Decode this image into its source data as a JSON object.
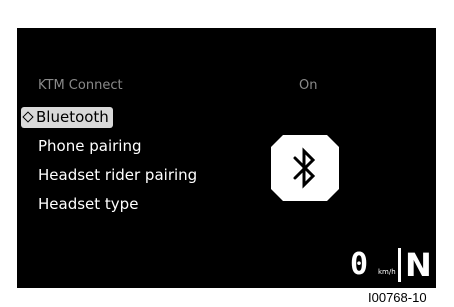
{
  "menu": {
    "header_label": "KTM Connect",
    "header_status": "On",
    "items": [
      {
        "label": "Bluetooth",
        "selected": true
      },
      {
        "label": "Phone pairing",
        "selected": false
      },
      {
        "label": "Headset rider pairing",
        "selected": false
      },
      {
        "label": "Headset type",
        "selected": false
      }
    ]
  },
  "status_bar": {
    "speed": "0",
    "speed_unit": "km/h",
    "gear": "N"
  },
  "icons": {
    "center": "bluetooth-icon",
    "selection_marker": "diamond-icon"
  },
  "figure_id": "I00768-10",
  "colors": {
    "screen_background": "#000000",
    "selected_background": "#d9d9d9",
    "dim_text": "#8a8a8a",
    "text": "#ffffff"
  }
}
